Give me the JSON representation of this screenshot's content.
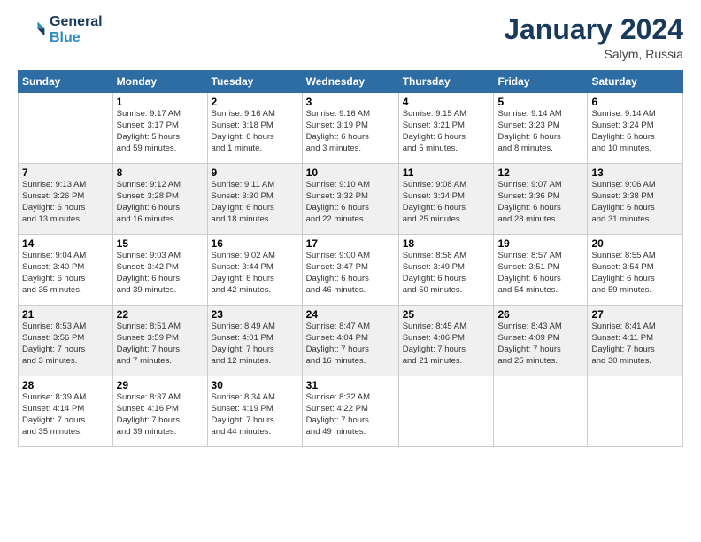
{
  "header": {
    "logo_line1": "General",
    "logo_line2": "Blue",
    "month": "January 2024",
    "location": "Salym, Russia"
  },
  "weekdays": [
    "Sunday",
    "Monday",
    "Tuesday",
    "Wednesday",
    "Thursday",
    "Friday",
    "Saturday"
  ],
  "weeks": [
    [
      {
        "day": "",
        "info": ""
      },
      {
        "day": "1",
        "info": "Sunrise: 9:17 AM\nSunset: 3:17 PM\nDaylight: 5 hours\nand 59 minutes."
      },
      {
        "day": "2",
        "info": "Sunrise: 9:16 AM\nSunset: 3:18 PM\nDaylight: 6 hours\nand 1 minute."
      },
      {
        "day": "3",
        "info": "Sunrise: 9:16 AM\nSunset: 3:19 PM\nDaylight: 6 hours\nand 3 minutes."
      },
      {
        "day": "4",
        "info": "Sunrise: 9:15 AM\nSunset: 3:21 PM\nDaylight: 6 hours\nand 5 minutes."
      },
      {
        "day": "5",
        "info": "Sunrise: 9:14 AM\nSunset: 3:23 PM\nDaylight: 6 hours\nand 8 minutes."
      },
      {
        "day": "6",
        "info": "Sunrise: 9:14 AM\nSunset: 3:24 PM\nDaylight: 6 hours\nand 10 minutes."
      }
    ],
    [
      {
        "day": "7",
        "info": "Sunrise: 9:13 AM\nSunset: 3:26 PM\nDaylight: 6 hours\nand 13 minutes."
      },
      {
        "day": "8",
        "info": "Sunrise: 9:12 AM\nSunset: 3:28 PM\nDaylight: 6 hours\nand 16 minutes."
      },
      {
        "day": "9",
        "info": "Sunrise: 9:11 AM\nSunset: 3:30 PM\nDaylight: 6 hours\nand 18 minutes."
      },
      {
        "day": "10",
        "info": "Sunrise: 9:10 AM\nSunset: 3:32 PM\nDaylight: 6 hours\nand 22 minutes."
      },
      {
        "day": "11",
        "info": "Sunrise: 9:08 AM\nSunset: 3:34 PM\nDaylight: 6 hours\nand 25 minutes."
      },
      {
        "day": "12",
        "info": "Sunrise: 9:07 AM\nSunset: 3:36 PM\nDaylight: 6 hours\nand 28 minutes."
      },
      {
        "day": "13",
        "info": "Sunrise: 9:06 AM\nSunset: 3:38 PM\nDaylight: 6 hours\nand 31 minutes."
      }
    ],
    [
      {
        "day": "14",
        "info": "Sunrise: 9:04 AM\nSunset: 3:40 PM\nDaylight: 6 hours\nand 35 minutes."
      },
      {
        "day": "15",
        "info": "Sunrise: 9:03 AM\nSunset: 3:42 PM\nDaylight: 6 hours\nand 39 minutes."
      },
      {
        "day": "16",
        "info": "Sunrise: 9:02 AM\nSunset: 3:44 PM\nDaylight: 6 hours\nand 42 minutes."
      },
      {
        "day": "17",
        "info": "Sunrise: 9:00 AM\nSunset: 3:47 PM\nDaylight: 6 hours\nand 46 minutes."
      },
      {
        "day": "18",
        "info": "Sunrise: 8:58 AM\nSunset: 3:49 PM\nDaylight: 6 hours\nand 50 minutes."
      },
      {
        "day": "19",
        "info": "Sunrise: 8:57 AM\nSunset: 3:51 PM\nDaylight: 6 hours\nand 54 minutes."
      },
      {
        "day": "20",
        "info": "Sunrise: 8:55 AM\nSunset: 3:54 PM\nDaylight: 6 hours\nand 59 minutes."
      }
    ],
    [
      {
        "day": "21",
        "info": "Sunrise: 8:53 AM\nSunset: 3:56 PM\nDaylight: 7 hours\nand 3 minutes."
      },
      {
        "day": "22",
        "info": "Sunrise: 8:51 AM\nSunset: 3:59 PM\nDaylight: 7 hours\nand 7 minutes."
      },
      {
        "day": "23",
        "info": "Sunrise: 8:49 AM\nSunset: 4:01 PM\nDaylight: 7 hours\nand 12 minutes."
      },
      {
        "day": "24",
        "info": "Sunrise: 8:47 AM\nSunset: 4:04 PM\nDaylight: 7 hours\nand 16 minutes."
      },
      {
        "day": "25",
        "info": "Sunrise: 8:45 AM\nSunset: 4:06 PM\nDaylight: 7 hours\nand 21 minutes."
      },
      {
        "day": "26",
        "info": "Sunrise: 8:43 AM\nSunset: 4:09 PM\nDaylight: 7 hours\nand 25 minutes."
      },
      {
        "day": "27",
        "info": "Sunrise: 8:41 AM\nSunset: 4:11 PM\nDaylight: 7 hours\nand 30 minutes."
      }
    ],
    [
      {
        "day": "28",
        "info": "Sunrise: 8:39 AM\nSunset: 4:14 PM\nDaylight: 7 hours\nand 35 minutes."
      },
      {
        "day": "29",
        "info": "Sunrise: 8:37 AM\nSunset: 4:16 PM\nDaylight: 7 hours\nand 39 minutes."
      },
      {
        "day": "30",
        "info": "Sunrise: 8:34 AM\nSunset: 4:19 PM\nDaylight: 7 hours\nand 44 minutes."
      },
      {
        "day": "31",
        "info": "Sunrise: 8:32 AM\nSunset: 4:22 PM\nDaylight: 7 hours\nand 49 minutes."
      },
      {
        "day": "",
        "info": ""
      },
      {
        "day": "",
        "info": ""
      },
      {
        "day": "",
        "info": ""
      }
    ]
  ]
}
